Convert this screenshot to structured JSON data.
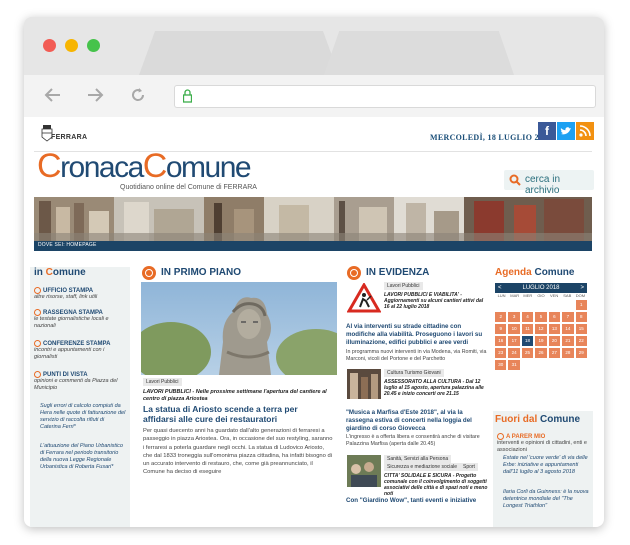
{
  "site": {
    "small_logo": "FERRARA",
    "date": "MERCOLEDÌ, 18 LUGLIO 2018",
    "brand_c1": "C",
    "brand_w1": "ronaca",
    "brand_c2": "C",
    "brand_w2": "omune",
    "tagline": "Quotidiano online del Comune di FERRARA",
    "search_label": "cerca in archivio",
    "breadcrumb": "DOVE SEI: HOMEPAGE"
  },
  "social": {
    "facebook": "f",
    "twitter": "t",
    "rss": "rss"
  },
  "sidebar": {
    "title_prefix": "in",
    "title_c": "C",
    "title_rest": "omune",
    "items": [
      {
        "head": "UFFICIO STAMPA",
        "sub": "altre risorse, staff, link utili"
      },
      {
        "head": "RASSEGNA STAMPA",
        "sub": "le testate giornalistiche locali e nazionali"
      },
      {
        "head": "CONFERENZE STAMPA",
        "sub": "incontri e appuntamenti con i giornalisti"
      },
      {
        "head": "PUNTI DI VISTA",
        "sub": "opinioni e commenti da Piazza del Municipio"
      }
    ],
    "links": [
      "Sugli errori di calcolo compiuti da Hera nelle quote di fatturazione del servizio di raccolta rifiuti di Caterina Ferri*",
      "L'attuazione del Piano Urbanistico di Ferrara nel periodo transitorio della nuova Legge Regionale Urbanistica di Roberta Fusari*"
    ]
  },
  "primo_piano": {
    "heading": "IN PRIMO PIANO",
    "tag": "Lavori Pubblici",
    "kicker": "LAVORI PUBBLICI - Nelle prossime settimane l'apertura del cantiere al centro di piazza Ariostea",
    "title": "La statua di Ariosto scende a terra per affidarsi alle cure dei restauratori",
    "body": "Per quasi duecento anni ha guardato dall'alto generazioni di ferraresi a passeggio in piazza Ariostea. Ora, in occasione del suo restyling, saranno i ferraresi a poterla guardare negli occhi. La statua di Ludovico Ariosto, che dal 1833 troneggia sull'omonima piazza cittadina, ha infatti bisogno di un accurato intervento di restauro, che, come già preannunciato, il Comune ha deciso di eseguire"
  },
  "evidenza": {
    "heading": "IN EVIDENZA",
    "items": [
      {
        "tag": "Lavori Pubblici",
        "kicker": "LAVORI PUBBLICI E VIABILITA' - Aggiornamenti su alcuni cantieri attivi dal 16 al 22 luglio 2018",
        "title": "Al via interventi su strade cittadine con modifiche alla viabilità. Proseguono i lavori su illuminazione, edifici pubblici e aree verdi",
        "body": "In programma nuovi interventi in via Modena, via Romiti, via Marconi, vicoli del Portone e del Parchetto"
      },
      {
        "tag": "Cultura Turismo Giovani",
        "kicker": "ASSESSORATO ALLA CULTURA - Dal 12 luglio al 15 agosto, apertura palazzina alle 20.45 e inizio concerti ore 21.15",
        "title": "\"Musica a Marfisa d'Este 2018\", al via la rassegna estiva di concerti nella loggia del giardino di corso Giovecca",
        "body": "L'ingresso è a offerta libera e consentirà anche di visitare Palazzina Marfisa (aperta dalle 20.45)"
      },
      {
        "tag": "Sanità, Servizi alla Persona",
        "tag2": "Sicurezza e mediazione sociale",
        "tag3": "Sport",
        "kicker": "CITTA' SOLIDALE E SICURA - Progetto comunale con il coinvolgimento di soggetti associativi delle città e di spazi noti e meno noti",
        "title": "Con \"Giardino Wow\", tanti eventi e iniziative"
      }
    ]
  },
  "agenda": {
    "title_w1": "Agenda",
    "title_c": "C",
    "title_rest": "omune",
    "month": "LUGLIO 2018",
    "prev": "<",
    "next": ">",
    "days": [
      "LUN",
      "MAR",
      "MER",
      "GIO",
      "VEN",
      "SAB",
      "DOM"
    ],
    "cells": [
      "",
      "",
      "",
      "",
      "",
      "",
      "1",
      "2",
      "3",
      "4",
      "5",
      "6",
      "7",
      "8",
      "9",
      "10",
      "11",
      "12",
      "13",
      "14",
      "15",
      "16",
      "17",
      "18",
      "19",
      "20",
      "21",
      "22",
      "23",
      "24",
      "25",
      "26",
      "27",
      "28",
      "29",
      "30",
      "31",
      "",
      "",
      "",
      "",
      ""
    ]
  },
  "fuori": {
    "title_w1": "Fuori dal",
    "title_c": "C",
    "title_rest": "omune",
    "parere_head": "A PARER MIO",
    "parere_sub": "interventi e opinioni di cittadini, enti e associazioni",
    "links": [
      "Estate nel 'cuore verde' di via delle Erbe: iniziative e appuntamenti dall'11 luglio al 3 agosto 2018",
      "Ilaria Corli da Guinness: è la nuova detentrice mondiale del \"The Longest Triathlon\""
    ]
  },
  "colors": {
    "accent": "#e86b25",
    "navy": "#204a73",
    "calendar": "#e8855a"
  }
}
